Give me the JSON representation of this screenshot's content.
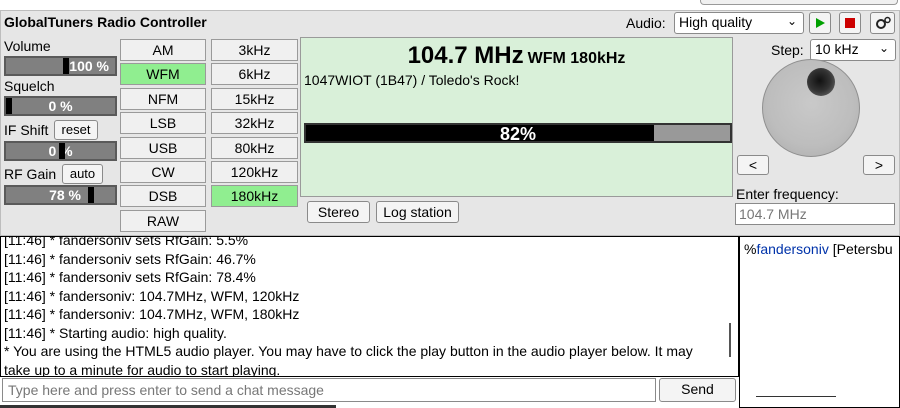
{
  "header": {
    "title": "GlobalTuners Radio Controller",
    "audio_label": "Audio:",
    "audio_quality": "High quality"
  },
  "controls": {
    "volume_label": "Volume",
    "volume_value": "100 %",
    "volume_level": 0.62,
    "squelch_label": "Squelch",
    "squelch_value": "0 %",
    "ifshift_label": "IF Shift",
    "ifshift_reset": "reset",
    "ifshift_value": "0 %",
    "rfgain_label": "RF Gain",
    "rfgain_auto": "auto",
    "rfgain_value": "78 %"
  },
  "modes": [
    "AM",
    "WFM",
    "NFM",
    "LSB",
    "USB",
    "CW",
    "DSB",
    "RAW"
  ],
  "active_mode": "WFM",
  "bandwidths": [
    "3kHz",
    "6kHz",
    "15kHz",
    "32kHz",
    "80kHz",
    "120kHz",
    "180kHz"
  ],
  "active_bandwidth": "180kHz",
  "display": {
    "frequency": "104.7 MHz",
    "mode_bw": "WFM 180kHz",
    "station": "1047WIOT (1B47) / Toledo's Rock!",
    "signal_text": "82%",
    "signal_level": 0.82,
    "stereo_button": "Stereo",
    "log_button": "Log station"
  },
  "tuning": {
    "step_label": "Step:",
    "step_value": "10 kHz",
    "enter_freq_label": "Enter frequency:",
    "freq_input_value": "104.7 MHz",
    "left_arrow": "<",
    "right_arrow": ">"
  },
  "chat": {
    "lines": [
      "[11:46] * fandersoniv sets RfGain: 5.5%",
      "[11:46] * fandersoniv sets RfGain: 46.7%",
      "[11:46] * fandersoniv sets RfGain: 78.4%",
      "[11:46] * fandersoniv: 104.7MHz, WFM, 120kHz",
      "[11:46] * fandersoniv: 104.7MHz, WFM, 180kHz",
      "[11:46] * Starting audio: high quality.",
      "* You are using the HTML5 audio player. You may have to click the play button in the audio player below. It may take up to a minute for audio to start playing."
    ],
    "input_placeholder": "Type here and press enter to send a chat message",
    "send_label": "Send"
  },
  "users": {
    "prefix": "%",
    "nick": "fandersoniv",
    "location": "[Petersbu"
  },
  "colors": {
    "active_green": "#90ee90",
    "display_bg": "#d9f0d9",
    "play_green": "#00a000",
    "stop_red": "#cc0000"
  }
}
